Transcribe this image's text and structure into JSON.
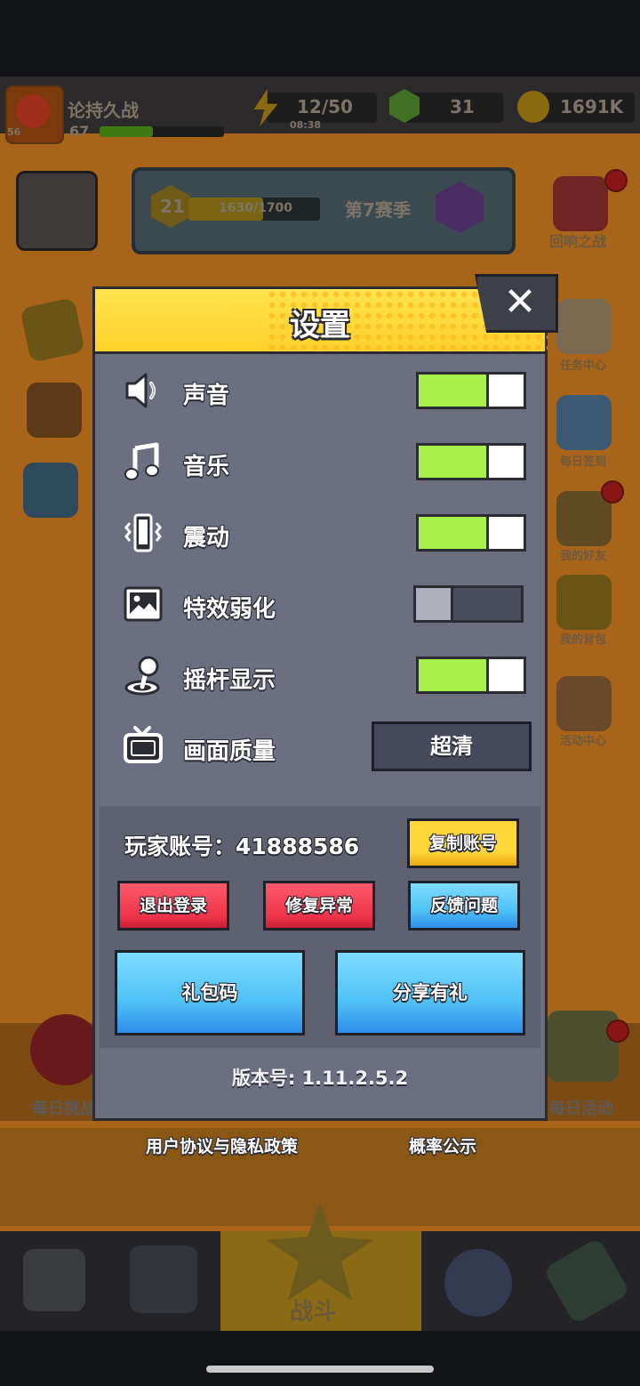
{
  "background": {
    "player_title": "论持久战",
    "player_level": "67",
    "avatar_badge": "56",
    "energy": "12/50",
    "energy_timer": "08:38",
    "gems": "31",
    "coins": "1691K",
    "season_level": "21",
    "season_progress": "1630/1700",
    "season_name": "第7赛季",
    "event_right": "回响之战",
    "side_items": [
      "任务中心",
      "每日签到",
      "我的好友",
      "我的背包",
      "活动中心"
    ],
    "bottom_left_label": "每日挑战",
    "bottom_right_label": "每日活动",
    "nav_center_label": "战斗"
  },
  "dialog": {
    "title": "设置",
    "close_symbol": "✕",
    "settings": [
      {
        "label": "声音",
        "icon": "speaker-icon",
        "enabled": true
      },
      {
        "label": "音乐",
        "icon": "music-note-icon",
        "enabled": true
      },
      {
        "label": "震动",
        "icon": "vibration-icon",
        "enabled": true
      },
      {
        "label": "特效弱化",
        "icon": "image-icon",
        "enabled": false
      },
      {
        "label": "摇杆显示",
        "icon": "joystick-icon",
        "enabled": true
      }
    ],
    "quality": {
      "label": "画面质量",
      "value": "超清"
    },
    "account": {
      "label": "玩家账号：",
      "id": "41888586",
      "copy_button": "复制账号",
      "logout_button": "退出登录",
      "repair_button": "修复异常",
      "feedback_button": "反馈问题",
      "gift_code_button": "礼包码",
      "share_button": "分享有礼"
    },
    "version": "版本号: 1.11.2.5.2"
  },
  "footer": {
    "agreement_link": "用户协议与隐私政策",
    "probability_link": "概率公示"
  },
  "colors": {
    "toggle_on": "#a8f04a",
    "header_yellow": "#ffd22a",
    "dialog_body": "#6c6f80",
    "btn_red": "#ee3348",
    "btn_blue": "#4fc2f5",
    "btn_yellow": "#ffd53a"
  }
}
